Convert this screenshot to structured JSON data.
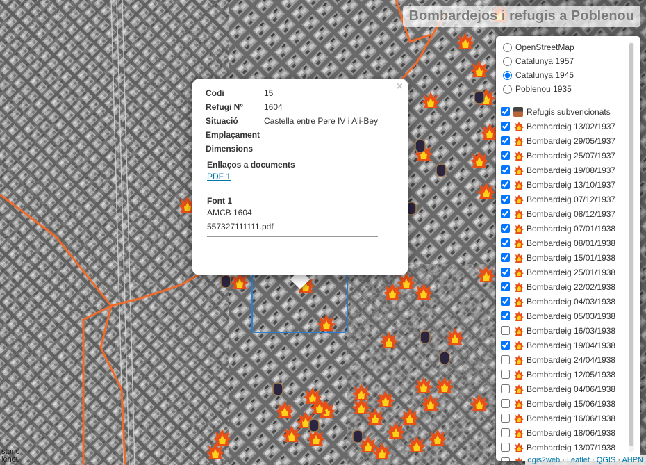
{
  "title": "Bombardejos i refugis a Poblenou",
  "popup": {
    "close": "×",
    "fields": [
      {
        "key": "Codi",
        "value": "15"
      },
      {
        "key": "Refugi Nº",
        "value": "1604"
      },
      {
        "key": "Situació",
        "value": "Castella entre Pere IV i Ali-Bey"
      },
      {
        "key": "Emplaçament",
        "value": ""
      },
      {
        "key": "Dimensions",
        "value": ""
      }
    ],
    "docs_label": "Enllaços a documents",
    "docs_link": "PDF 1",
    "font_label": "Font 1",
    "font_value": "AMCB 1604",
    "font_file": "557327111111.pdf"
  },
  "layers": {
    "base": [
      {
        "label": "OpenStreetMap",
        "checked": false
      },
      {
        "label": "Catalunya 1957",
        "checked": false
      },
      {
        "label": "Catalunya 1945",
        "checked": true
      },
      {
        "label": "Poblenou 1935",
        "checked": false
      }
    ],
    "overlays": [
      {
        "label": "Refugis subvencionats",
        "checked": true,
        "icon": "shelter-icon"
      },
      {
        "label": "Bombardeig 13/02/1937",
        "checked": true,
        "icon": "fire-icon"
      },
      {
        "label": "Bombardeig 29/05/1937",
        "checked": true,
        "icon": "fire-icon"
      },
      {
        "label": "Bombardeig 25/07/1937",
        "checked": true,
        "icon": "fire-icon"
      },
      {
        "label": "Bombardeig 19/08/1937",
        "checked": true,
        "icon": "fire-icon"
      },
      {
        "label": "Bombardeig 13/10/1937",
        "checked": true,
        "icon": "fire-icon"
      },
      {
        "label": "Bombardeig 07/12/1937",
        "checked": true,
        "icon": "fire-icon"
      },
      {
        "label": "Bombardeig 08/12/1937",
        "checked": true,
        "icon": "fire-icon"
      },
      {
        "label": "Bombardeig 07/01/1938",
        "checked": true,
        "icon": "fire-icon"
      },
      {
        "label": "Bombardeig 08/01/1938",
        "checked": true,
        "icon": "fire-icon"
      },
      {
        "label": "Bombardeig 15/01/1938",
        "checked": true,
        "icon": "fire-icon"
      },
      {
        "label": "Bombardeig 25/01/1938",
        "checked": true,
        "icon": "fire-icon"
      },
      {
        "label": "Bombardeig 22/02/1938",
        "checked": true,
        "icon": "fire-icon"
      },
      {
        "label": "Bombardeig 04/03/1938",
        "checked": true,
        "icon": "fire-icon"
      },
      {
        "label": "Bombardeig 05/03/1938",
        "checked": true,
        "icon": "fire-icon"
      },
      {
        "label": "Bombardeig 16/03/1938",
        "checked": false,
        "icon": "fire-icon"
      },
      {
        "label": "Bombardeig 19/04/1938",
        "checked": true,
        "icon": "fire-icon"
      },
      {
        "label": "Bombardeig 24/04/1938",
        "checked": false,
        "icon": "fire-icon"
      },
      {
        "label": "Bombardeig 12/05/1938",
        "checked": false,
        "icon": "fire-icon"
      },
      {
        "label": "Bombardeig 04/06/1938",
        "checked": false,
        "icon": "fire-icon"
      },
      {
        "label": "Bombardeig 15/06/1938",
        "checked": false,
        "icon": "fire-icon"
      },
      {
        "label": "Bombardeig 16/06/1938",
        "checked": false,
        "icon": "fire-icon"
      },
      {
        "label": "Bombardeig 18/06/1938",
        "checked": false,
        "icon": "fire-icon"
      },
      {
        "label": "Bombardeig 13/07/1938",
        "checked": false,
        "icon": "fire-icon"
      },
      {
        "label": "Bombardeig",
        "checked": false,
        "icon": "fire-icon"
      }
    ]
  },
  "attribution": {
    "qgis2web": "qgis2web",
    "leaflet": "Leaflet",
    "qgis": "QGIS",
    "ahpn": "AHPN",
    "sep": " · "
  },
  "coords": {
    "line1": "storic",
    "line2": "lenou"
  },
  "colors": {
    "boundary": "#f06a2a",
    "highlight": "#2a7fd4",
    "fire_outer": "#e8501a",
    "fire_inner": "#ffd21a"
  }
}
